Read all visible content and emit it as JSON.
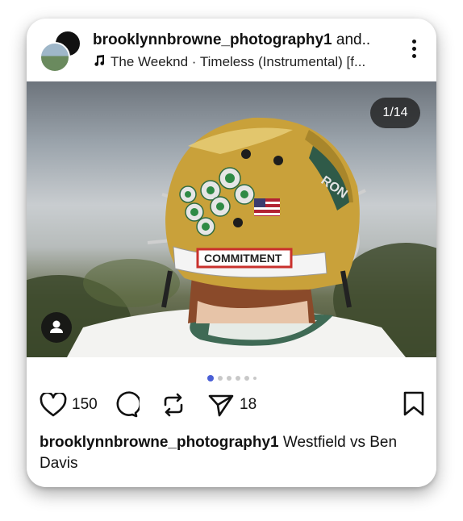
{
  "post": {
    "header": {
      "username": "brooklynnbrowne_photography1",
      "coauthors_suffix": " and..",
      "music": "The Weeknd · Timeless (Instrumental) [f..."
    },
    "media": {
      "page_counter": "1/14",
      "helmet_sticker": "COMMITMENT",
      "helmet_side_text": "RON",
      "carousel": {
        "total_dots": 6,
        "active_index": 0
      }
    },
    "actions": {
      "likes": "150",
      "shares": "18"
    },
    "caption": {
      "username": "brooklynnbrowne_photography1",
      "text": " Westfield vs Ben Davis"
    }
  },
  "colors": {
    "accent_dot": "#4a5fd6",
    "helmet_gold": "#c9a13a"
  },
  "icons": [
    "music-note-icon",
    "more-vert-icon",
    "user-tag-icon",
    "heart-icon",
    "comment-icon",
    "repost-icon",
    "share-icon",
    "bookmark-icon"
  ]
}
